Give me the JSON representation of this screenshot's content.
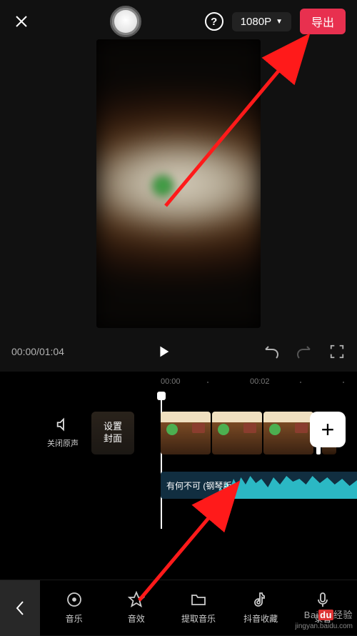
{
  "topbar": {
    "resolution_label": "1080P",
    "export_label": "导出"
  },
  "playback": {
    "current_time": "00:00",
    "total_time": "01:04"
  },
  "timeline": {
    "ticks": [
      "00:00",
      "00:02"
    ],
    "mute_label": "关闭原声",
    "cover_label": "设置\n封面",
    "audio_track_label": "有何不可 (钢琴版"
  },
  "nav": {
    "items": [
      {
        "label": "音乐",
        "icon": "disc-icon"
      },
      {
        "label": "音效",
        "icon": "star-icon"
      },
      {
        "label": "提取音乐",
        "icon": "folder-icon"
      },
      {
        "label": "抖音收藏",
        "icon": "douyin-icon"
      },
      {
        "label": "录音",
        "icon": "mic-icon"
      }
    ]
  },
  "watermark": {
    "brand_prefix": "Bai",
    "brand_mid": "du",
    "brand_suffix": "经验",
    "url": "jingyan.baidu.com"
  }
}
